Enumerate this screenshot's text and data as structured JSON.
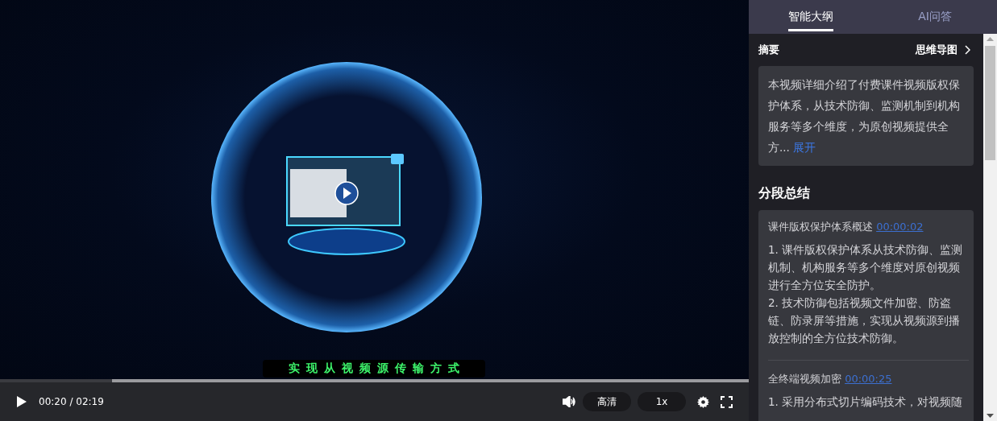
{
  "player": {
    "caption": "实现从视频源传输方式",
    "progress": {
      "level": 0.15
    },
    "time": "00:20 / 02:19",
    "quality": "高清",
    "speed": "1x"
  },
  "panel": {
    "tabs": [
      {
        "label": "智能大纲",
        "selected": true
      },
      {
        "label": "AI问答",
        "selected": false
      }
    ],
    "summary": {
      "title": "摘要",
      "mindmap_link": "思维导图",
      "text": "本视频详细介绍了付费课件视频版权保护体系，从技术防御、监测机制到机构服务等多个维度，为原创视频提供全方...",
      "expand": "展开"
    },
    "sections_title": "分段总结",
    "sections": [
      {
        "title": "课件版权保护体系概述",
        "time": "00:00:02",
        "points": [
          "1. 课件版权保护体系从技术防御、监测机制、机构服务等多个维度对原创视频进行全方位安全防护。",
          "2. 技术防御包括视频文件加密、防盗链、防录屏等措施，实现从视频源到播放控制的全方位技术防御。"
        ]
      },
      {
        "title": "全终端视频加密",
        "time": "00:00:25",
        "points": [
          "1. 采用分布式切片编码技术，对视频随"
        ]
      }
    ]
  }
}
